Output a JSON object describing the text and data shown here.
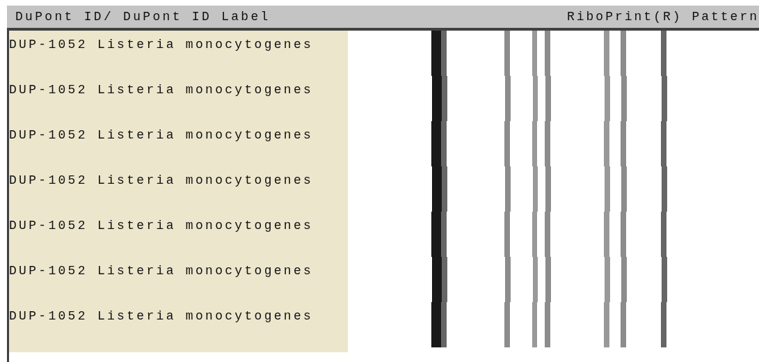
{
  "table": {
    "columns": [
      "DuPont ID/ DuPont ID Label",
      "RiboPrint(R) Pattern"
    ],
    "rows": [
      {
        "label": "DUP-1052 Listeria monocytogenes"
      },
      {
        "label": "DUP-1052 Listeria monocytogenes"
      },
      {
        "label": "DUP-1052 Listeria monocytogenes"
      },
      {
        "label": "DUP-1052 Listeria monocytogenes"
      },
      {
        "label": "DUP-1052 Listeria monocytogenes"
      },
      {
        "label": "DUP-1052 Listeria monocytogenes"
      },
      {
        "label": "DUP-1052 Listeria monocytogenes"
      }
    ]
  }
}
